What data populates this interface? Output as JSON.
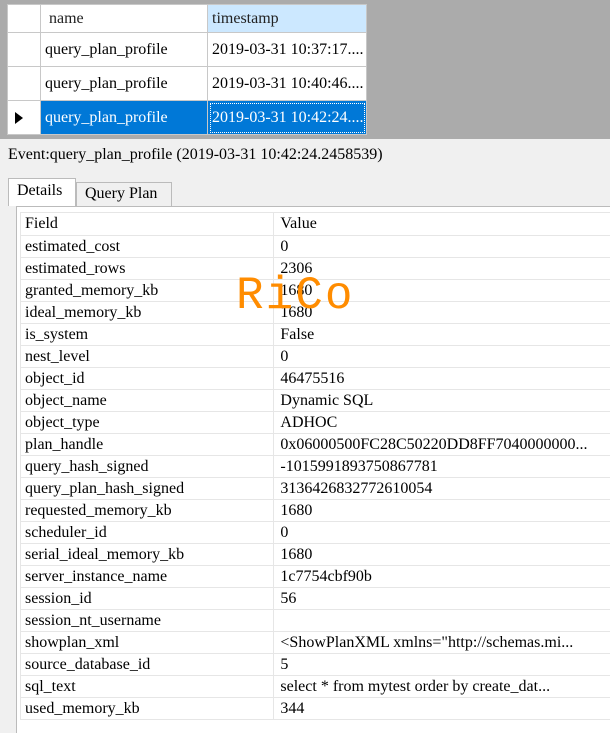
{
  "grid": {
    "columns": [
      "name",
      "timestamp"
    ],
    "rows": [
      {
        "name": "query_plan_profile",
        "timestamp": "2019-03-31 10:37:17...."
      },
      {
        "name": "query_plan_profile",
        "timestamp": "2019-03-31 10:40:46...."
      },
      {
        "name": "query_plan_profile",
        "timestamp": "2019-03-31 10:42:24...."
      }
    ],
    "selected_index": 2,
    "selection_color": "#0078d7"
  },
  "event_title": "Event:query_plan_profile (2019-03-31 10:42:24.2458539)",
  "tabs": [
    "Details",
    "Query Plan"
  ],
  "details": {
    "headers": [
      "Field",
      "Value"
    ],
    "rows": [
      [
        "estimated_cost",
        "0"
      ],
      [
        "estimated_rows",
        "2306"
      ],
      [
        "granted_memory_kb",
        "1680"
      ],
      [
        "ideal_memory_kb",
        "1680"
      ],
      [
        "is_system",
        "False"
      ],
      [
        "nest_level",
        "0"
      ],
      [
        "object_id",
        "46475516"
      ],
      [
        "object_name",
        "Dynamic SQL"
      ],
      [
        "object_type",
        "ADHOC"
      ],
      [
        "plan_handle",
        "0x06000500FC28C50220DD8FF7040000000..."
      ],
      [
        "query_hash_signed",
        "-1015991893750867781"
      ],
      [
        "query_plan_hash_signed",
        "3136426832772610054"
      ],
      [
        "requested_memory_kb",
        "1680"
      ],
      [
        "scheduler_id",
        "0"
      ],
      [
        "serial_ideal_memory_kb",
        "1680"
      ],
      [
        "server_instance_name",
        "1c7754cbf90b"
      ],
      [
        "session_id",
        "56"
      ],
      [
        "session_nt_username",
        ""
      ],
      [
        "showplan_xml",
        "<ShowPlanXML xmlns=\"http://schemas.mi..."
      ],
      [
        "source_database_id",
        "5"
      ],
      [
        "sql_text",
        "select *   from mytest  order by create_dat..."
      ],
      [
        "used_memory_kb",
        "344"
      ]
    ]
  },
  "watermark": "RiCo",
  "watermark_color": "#ff8c00"
}
